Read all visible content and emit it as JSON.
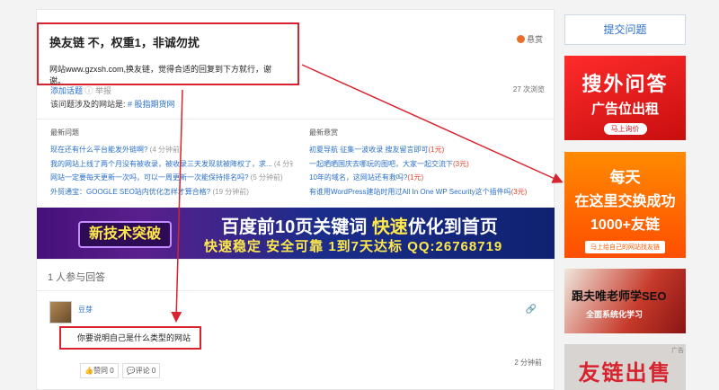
{
  "question": {
    "title": "换友链 不，权重1，非诚勿扰",
    "description": "网站www.gzxsh.com,换友链，觉得合适的回复到下方就行，谢谢。",
    "reward_label": "悬赏",
    "add_topic": "添加话题",
    "report": "举报",
    "views": "27 次浏览",
    "site_prefix": "该问题涉及的网站是: ",
    "site_tag": "# 股指期货网"
  },
  "latest": {
    "heading": "最新问题",
    "items": [
      {
        "text": "现在还有什么平台能发外链啊?",
        "time": " (4 分钟前)"
      },
      {
        "text": "我的网站上线了两个月没有被收录，被收录三天发现就被降权了，求...",
        "time": " (4 分钟前)"
      },
      {
        "text": "网站一定要每天更新一次吗，可以一周更新一次能保持排名吗?",
        "time": " (5 分钟前)"
      },
      {
        "text": "外贸通宝：GOOGLE SEO站内优化怎样才算合格?",
        "time": " (19 分钟前)"
      }
    ]
  },
  "bounty": {
    "heading": "最新悬赏",
    "items": [
      {
        "text": "初夏导航 征集一波收录 搜友留言即可",
        "reward": "(1元)"
      },
      {
        "text": "一起晒晒国庆去哪玩的图吧，大家一起交流下",
        "reward": "(3元)"
      },
      {
        "text": "10年的域名，这网站还有救吗?",
        "reward": "(1元)"
      },
      {
        "text": "有谁用WordPress建站时用过All In One WP Security这个插件吗",
        "reward": "(3元)"
      }
    ]
  },
  "banner": {
    "badge": "新技术突破",
    "line1_a": "百度前10页关键词 ",
    "line1_b": "快速",
    "line1_c": "优化到首页",
    "line2": "快速稳定 安全可靠 1到7天达标 QQ:26768719"
  },
  "answers": {
    "count_label": "1 人参与回答",
    "items": [
      {
        "user": "豆芽",
        "text": "你要说明自己是什么类型的网站",
        "time": "2 分钟前",
        "like": "赞同 0",
        "comment": "评论 0"
      }
    ]
  },
  "sidebar": {
    "ask_button": "提交问题",
    "ad1": {
      "a": "搜外问答",
      "b": "广告位出租",
      "c": "马上询价"
    },
    "ad2": {
      "a": "每天",
      "b": "在这里交换成功",
      "c": "1000+友链",
      "d": "马上给自己的网站找友链"
    },
    "ad3": {
      "a": "跟夫唯老师学SEO",
      "b": "全面系统化学习"
    },
    "ad4": {
      "a": "友链出售",
      "tag": "广告"
    }
  },
  "colors": {
    "annotation_red": "#d7232e",
    "link_blue": "#2b70c9"
  }
}
